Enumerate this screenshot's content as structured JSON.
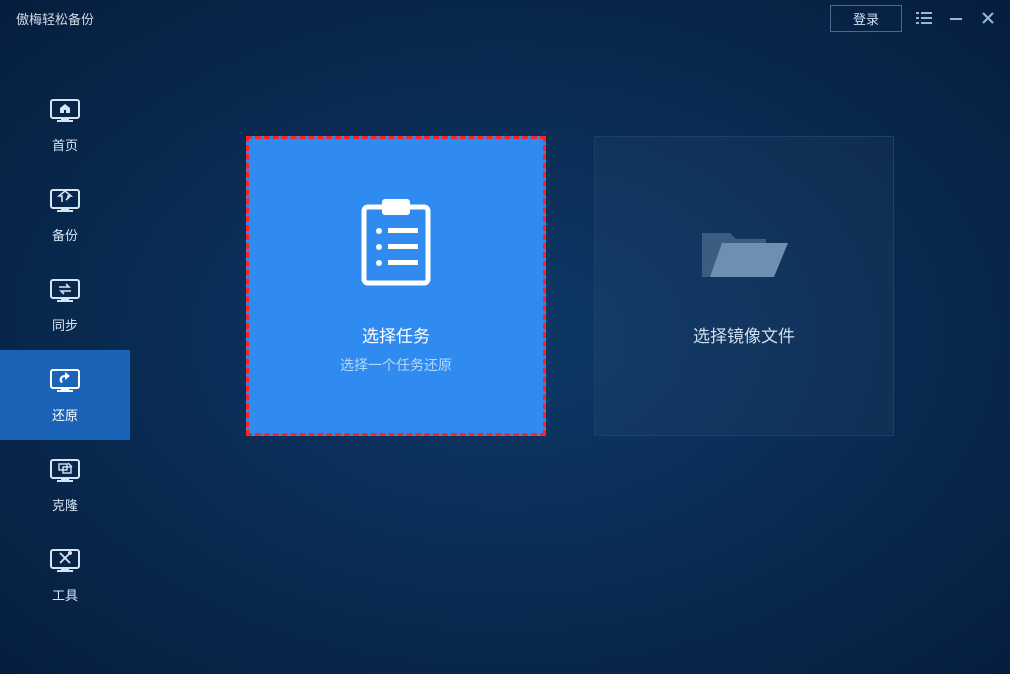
{
  "titlebar": {
    "app_title": "傲梅轻松备份",
    "login_label": "登录"
  },
  "sidebar": {
    "items": [
      {
        "label": "首页"
      },
      {
        "label": "备份"
      },
      {
        "label": "同步"
      },
      {
        "label": "还原"
      },
      {
        "label": "克隆"
      },
      {
        "label": "工具"
      }
    ]
  },
  "main": {
    "task_card": {
      "title": "选择任务",
      "subtitle": "选择一个任务还原"
    },
    "image_card": {
      "title": "选择镜像文件"
    }
  }
}
